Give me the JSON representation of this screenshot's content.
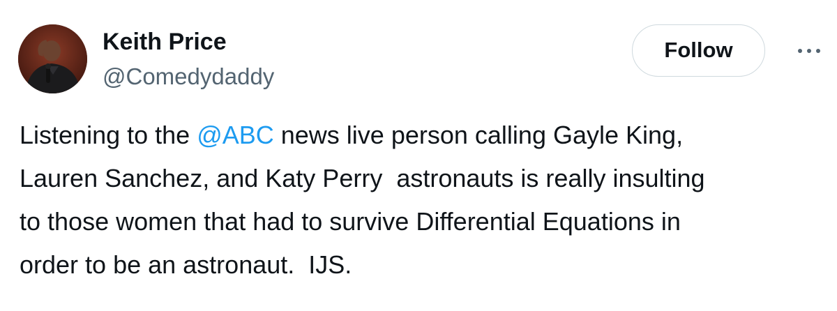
{
  "author": {
    "display_name": "Keith Price",
    "handle": "@Comedydaddy"
  },
  "actions": {
    "follow_label": "Follow",
    "more_icon": "more-dots-icon"
  },
  "tweet": {
    "line1_before": "Listening to the ",
    "mention": "@ABC",
    "line1_after": " news live person calling Gayle King,",
    "line2": "Lauren Sanchez, and Katy Perry  astronauts is really insulting",
    "line3": "to those women that had to survive Differential Equations in",
    "line4": "order to be an astronaut.  IJS."
  },
  "colors": {
    "text": "#0f1419",
    "secondary": "#536471",
    "link": "#1d9bf0",
    "border": "#cfd9de"
  }
}
